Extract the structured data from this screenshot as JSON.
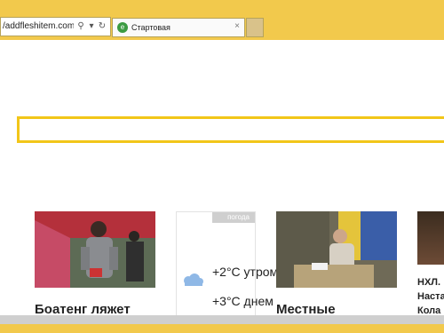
{
  "browser": {
    "address_text": "/addfleshitem.com/r",
    "search_icon": "search-icon",
    "dropdown_icon": "chevron-down-icon",
    "refresh_icon": "refresh-icon",
    "tab_title": "Стартовая",
    "tab_close": "×"
  },
  "colors": {
    "frame": "#f2c94c",
    "search_border": "#f2c619",
    "favicon": "#3c9b43"
  },
  "cards": [
    {
      "title": "Боатенг ляжет"
    },
    {
      "title": "Местные"
    }
  ],
  "weather": {
    "tag": "погода",
    "rows": [
      "+2°C утром",
      "+3°C днем"
    ]
  },
  "right_card": {
    "lines": [
      "НХЛ.",
      "Наста",
      "Кола"
    ]
  }
}
